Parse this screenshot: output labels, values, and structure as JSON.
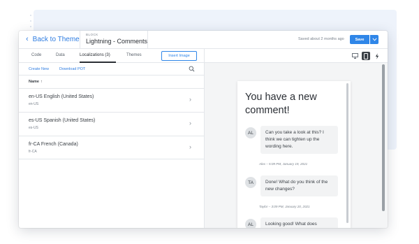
{
  "header": {
    "back_label": "Back to Theme",
    "eyebrow": "BLOCK",
    "title": "Lightning - Comments",
    "saved_text": "Saved about 2 months ago",
    "save_label": "Save"
  },
  "tabs": [
    {
      "label": "Code",
      "active": false
    },
    {
      "label": "Data",
      "active": false
    },
    {
      "label": "Localizations (3)",
      "active": true
    },
    {
      "label": "Themes",
      "active": false
    }
  ],
  "insert_image_label": "Insert Image",
  "actions": {
    "create_new": "Create New",
    "download_pot": "Download POT"
  },
  "list": {
    "column_header": "Name",
    "sort_arrow": "↑",
    "rows": [
      {
        "name": "en-US English (United States)",
        "code": "en-US"
      },
      {
        "name": "es-US Spanish (United States)",
        "code": "es-US"
      },
      {
        "name": "fr-CA French (Canada)",
        "code": "fr-CA"
      }
    ]
  },
  "preview": {
    "heading": "You have a new comment!",
    "messages": [
      {
        "initials": "AL",
        "text": "Can you take a look at this? I think we can tighten up the wording here.",
        "meta": "Alex – 5:09 PM, January 19, 2021"
      },
      {
        "initials": "TA",
        "text": "Done! What do you think of the new changes?",
        "meta": "Taylor – 3:09 PM, January 20, 2021"
      },
      {
        "initials": "AL",
        "text": "Looking good! What does",
        "meta": ""
      }
    ]
  },
  "colors": {
    "accent": "#2f86e8",
    "link": "#2f7de1",
    "text": "#2b2f35"
  }
}
